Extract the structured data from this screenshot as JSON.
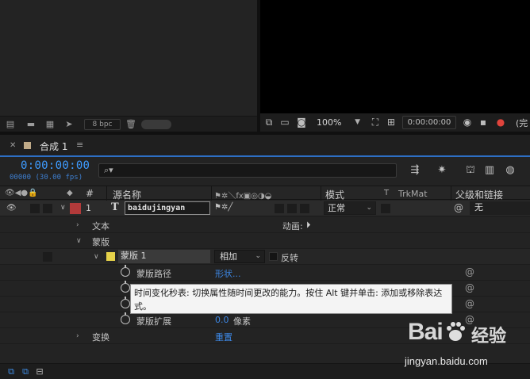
{
  "project_panel": {
    "bit_depth": "8 bpc",
    "footer_icons": [
      "interpret-footage-icon",
      "folder-icon",
      "new-composition-icon",
      "render-queue-icon",
      "trash-icon"
    ]
  },
  "viewer": {
    "zoom": "100%",
    "timecode": "0:00:00:00",
    "resolution_label": "(完"
  },
  "timeline": {
    "tab": {
      "name": "合成 1",
      "menu": "≡"
    },
    "current_time": "0:00:00:00",
    "fps_line": "00000 (30.00 fps)",
    "search_placeholder": "",
    "headers": {
      "number": "#",
      "source_name": "源名称",
      "mode": "模式",
      "t": "T",
      "trkmat": "TrkMat",
      "parent": "父级和链接"
    },
    "layer": {
      "index": "1",
      "type_glyph": "T",
      "name": "baidujingyan",
      "mode": "正常",
      "parent": "无",
      "label_color": "#b23a3a"
    },
    "properties": {
      "text": "文本",
      "animate": "动画:",
      "masks": "蒙版",
      "mask_name": "蒙版 1",
      "mask_mode": "相加",
      "inverted": "反转",
      "mask_path": "蒙版路径",
      "mask_path_value": "形状...",
      "mask_expansion": "蒙版扩展",
      "mask_expansion_value": "0.0",
      "mask_expansion_unit": "像素",
      "transform": "变换",
      "transform_reset": "重置",
      "mask_color": "#e6d24a"
    },
    "tooltip": "时间变化秒表: 切换属性随时间更改的能力。按住 Alt 键并单击: 添加或移除表达式。"
  },
  "watermark": {
    "logo": "Bai",
    "logo_cn": "经验",
    "url": "jingyan.baidu.com"
  }
}
